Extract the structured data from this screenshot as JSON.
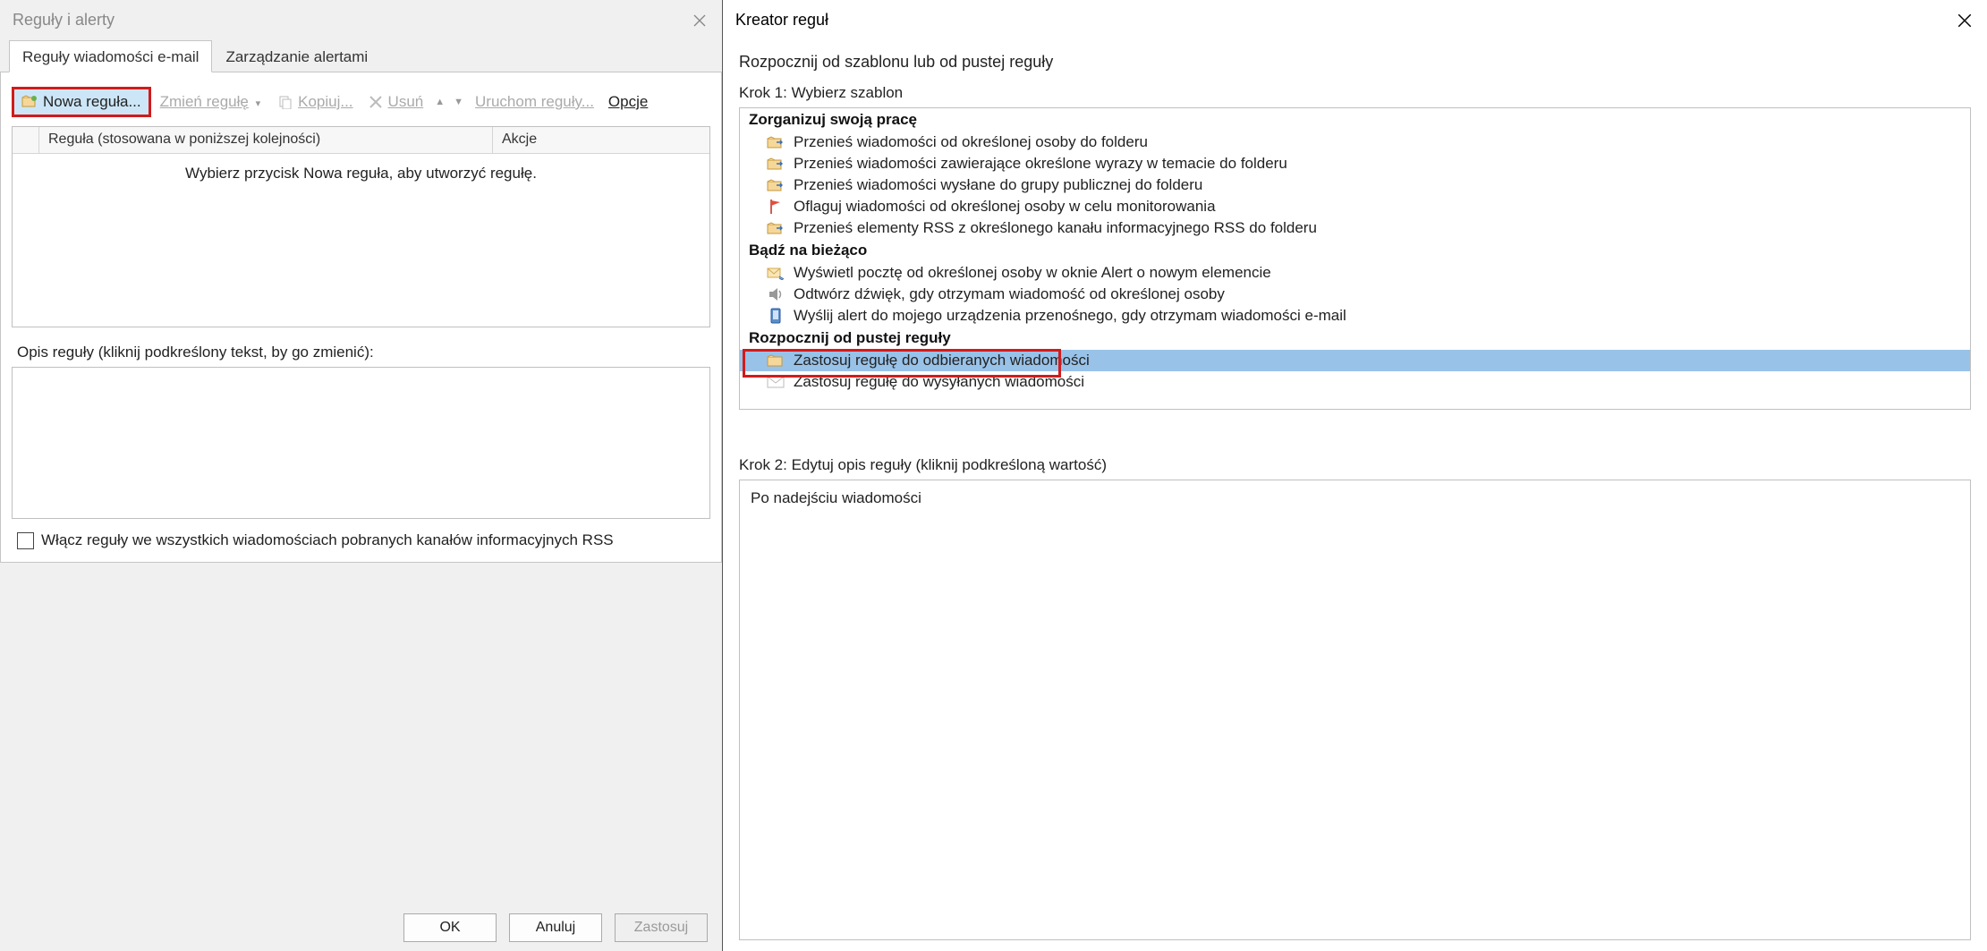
{
  "left": {
    "title": "Reguły i alerty",
    "tabs": [
      {
        "label": "Reguły wiadomości e-mail",
        "active": true
      },
      {
        "label": "Zarządzanie alertami",
        "active": false
      }
    ],
    "toolbar": {
      "new_rule": "Nowa reguła...",
      "change_rule": "Zmień regułę",
      "copy": "Kopiuj...",
      "delete": "Usuń",
      "run_rules": "Uruchom reguły...",
      "options": "Opcje"
    },
    "grid": {
      "col_rule": "Reguła (stosowana w poniższej kolejności)",
      "col_actions": "Akcje",
      "empty_msg": "Wybierz przycisk Nowa reguła, aby utworzyć regułę."
    },
    "desc_label": "Opis reguły (kliknij podkreślony tekst, by go zmienić):",
    "rss_checkbox": "Włącz reguły we wszystkich wiadomościach pobranych kanałów informacyjnych RSS",
    "buttons": {
      "ok": "OK",
      "cancel": "Anuluj",
      "apply": "Zastosuj"
    }
  },
  "right": {
    "title": "Kreator reguł",
    "heading": "Rozpocznij od szablonu lub od pustej reguły",
    "step1_label": "Krok 1: Wybierz szablon",
    "categories": [
      {
        "name": "Zorganizuj swoją pracę",
        "items": [
          {
            "icon": "folder-move",
            "label": "Przenieś wiadomości od określonej osoby do folderu"
          },
          {
            "icon": "folder-move",
            "label": "Przenieś wiadomości zawierające określone wyrazy w temacie do folderu"
          },
          {
            "icon": "folder-move",
            "label": "Przenieś wiadomości wysłane do grupy publicznej do folderu"
          },
          {
            "icon": "flag",
            "label": "Oflaguj wiadomości od określonej osoby w celu monitorowania"
          },
          {
            "icon": "folder-move",
            "label": "Przenieś elementy RSS z określonego kanału informacyjnego RSS do folderu"
          }
        ]
      },
      {
        "name": "Bądź na bieżąco",
        "items": [
          {
            "icon": "alert",
            "label": "Wyświetl pocztę od określonej osoby w oknie Alert o nowym elemencie"
          },
          {
            "icon": "sound",
            "label": "Odtwórz dźwięk, gdy otrzymam wiadomość od określonej osoby"
          },
          {
            "icon": "mobile",
            "label": "Wyślij alert do mojego urządzenia przenośnego, gdy otrzymam wiadomości e-mail"
          }
        ]
      },
      {
        "name": "Rozpocznij od pustej reguły",
        "items": [
          {
            "icon": "folder",
            "label": "Zastosuj regułę do odbieranych wiadomości",
            "selected": true,
            "red_frame": true
          },
          {
            "icon": "envelope",
            "label": "Zastosuj regułę do wysyłanych wiadomości"
          }
        ]
      }
    ],
    "step2_label": "Krok 2: Edytuj opis reguły (kliknij podkreśloną wartość)",
    "step2_text": "Po nadejściu wiadomości"
  }
}
